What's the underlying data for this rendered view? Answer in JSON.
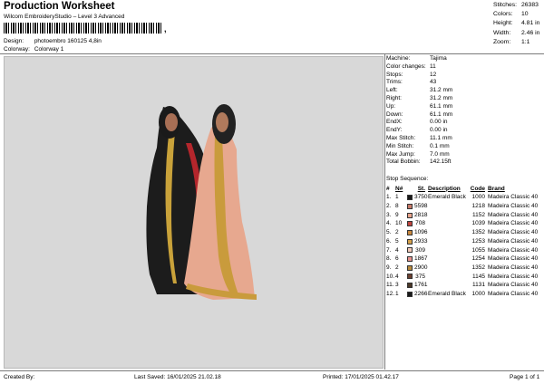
{
  "header": {
    "title": "Production Worksheet",
    "subtitle": "Wilcom EmbroideryStudio – Level 3 Advanced",
    "barcode_text": ",",
    "design_label": "Design:",
    "design_value": "photoembro 160125 4,8in",
    "colorway_label": "Colorway:",
    "colorway_value": "Colorway 1"
  },
  "stats": [
    {
      "label": "Stitches:",
      "value": "26383"
    },
    {
      "label": "Colors:",
      "value": "10"
    },
    {
      "label": "Height:",
      "value": "4.81 in"
    },
    {
      "label": "Width:",
      "value": "2.46 in"
    },
    {
      "label": "Zoom:",
      "value": "1:1"
    }
  ],
  "specs": [
    {
      "label": "Machine:",
      "value": "Tajima"
    },
    {
      "label": "Color changes:",
      "value": "11"
    },
    {
      "label": "Stops:",
      "value": "12"
    },
    {
      "label": "Trims:",
      "value": "43"
    },
    {
      "label": "Left:",
      "value": "31.2 mm"
    },
    {
      "label": "Right:",
      "value": "31.2 mm"
    },
    {
      "label": "Up:",
      "value": "61.1 mm"
    },
    {
      "label": "Down:",
      "value": "61.1 mm"
    },
    {
      "label": "EndX:",
      "value": "0.00 in"
    },
    {
      "label": "EndY:",
      "value": "0.00 in"
    },
    {
      "label": "Max Stitch:",
      "value": "11.1 mm"
    },
    {
      "label": "Min Stitch:",
      "value": "0.1 mm"
    },
    {
      "label": "Max Jump:",
      "value": "7.0 mm"
    },
    {
      "label": "Total Bobbin:",
      "value": "142.15ft"
    }
  ],
  "stop_sequence": {
    "title": "Stop Sequence:",
    "headers": [
      "#",
      "N#",
      "St.",
      "Description",
      "Code",
      "Brand"
    ],
    "rows": [
      {
        "no": "1.",
        "stop": "1",
        "color": "#1a1a1a",
        "st": "3750",
        "desc": "Emerald Black",
        "code": "1000",
        "brand": "Madeira Classic 40"
      },
      {
        "no": "2.",
        "stop": "8",
        "color": "#c77a6a",
        "st": "5598",
        "desc": "",
        "code": "1218",
        "brand": "Madeira Classic 40"
      },
      {
        "no": "3.",
        "stop": "9",
        "color": "#e8a48c",
        "st": "2818",
        "desc": "",
        "code": "1152",
        "brand": "Madeira Classic 40"
      },
      {
        "no": "4.",
        "stop": "10",
        "color": "#c0453e",
        "st": "708",
        "desc": "",
        "code": "1039",
        "brand": "Madeira Classic 40"
      },
      {
        "no": "5.",
        "stop": "2",
        "color": "#c9893f",
        "st": "1096",
        "desc": "",
        "code": "1352",
        "brand": "Madeira Classic 40"
      },
      {
        "no": "6.",
        "stop": "5",
        "color": "#d4a04a",
        "st": "2933",
        "desc": "",
        "code": "1253",
        "brand": "Madeira Classic 40"
      },
      {
        "no": "7.",
        "stop": "4",
        "color": "#f1c9b8",
        "st": "309",
        "desc": "",
        "code": "1055",
        "brand": "Madeira Classic 40"
      },
      {
        "no": "8.",
        "stop": "6",
        "color": "#e7928d",
        "st": "1867",
        "desc": "",
        "code": "1254",
        "brand": "Madeira Classic 40"
      },
      {
        "no": "9.",
        "stop": "2",
        "color": "#b88a3c",
        "st": "2900",
        "desc": "",
        "code": "1352",
        "brand": "Madeira Classic 40"
      },
      {
        "no": "10.",
        "stop": "4",
        "color": "#6b4030",
        "st": "375",
        "desc": "",
        "code": "1145",
        "brand": "Madeira Classic 40"
      },
      {
        "no": "11.",
        "stop": "3",
        "color": "#4a3828",
        "st": "1761",
        "desc": "",
        "code": "1131",
        "brand": "Madeira Classic 40"
      },
      {
        "no": "12.",
        "stop": "1",
        "color": "#1a1a1a",
        "st": "2266",
        "desc": "Emerald Black",
        "code": "1000",
        "brand": "Madeira Classic 40"
      }
    ]
  },
  "footer": {
    "created": "Created By:",
    "saved": "Last Saved: 16/01/2025 21.02.18",
    "printed": "Printed: 17/01/2025 01.42.17",
    "page": "Page 1 of 1"
  }
}
